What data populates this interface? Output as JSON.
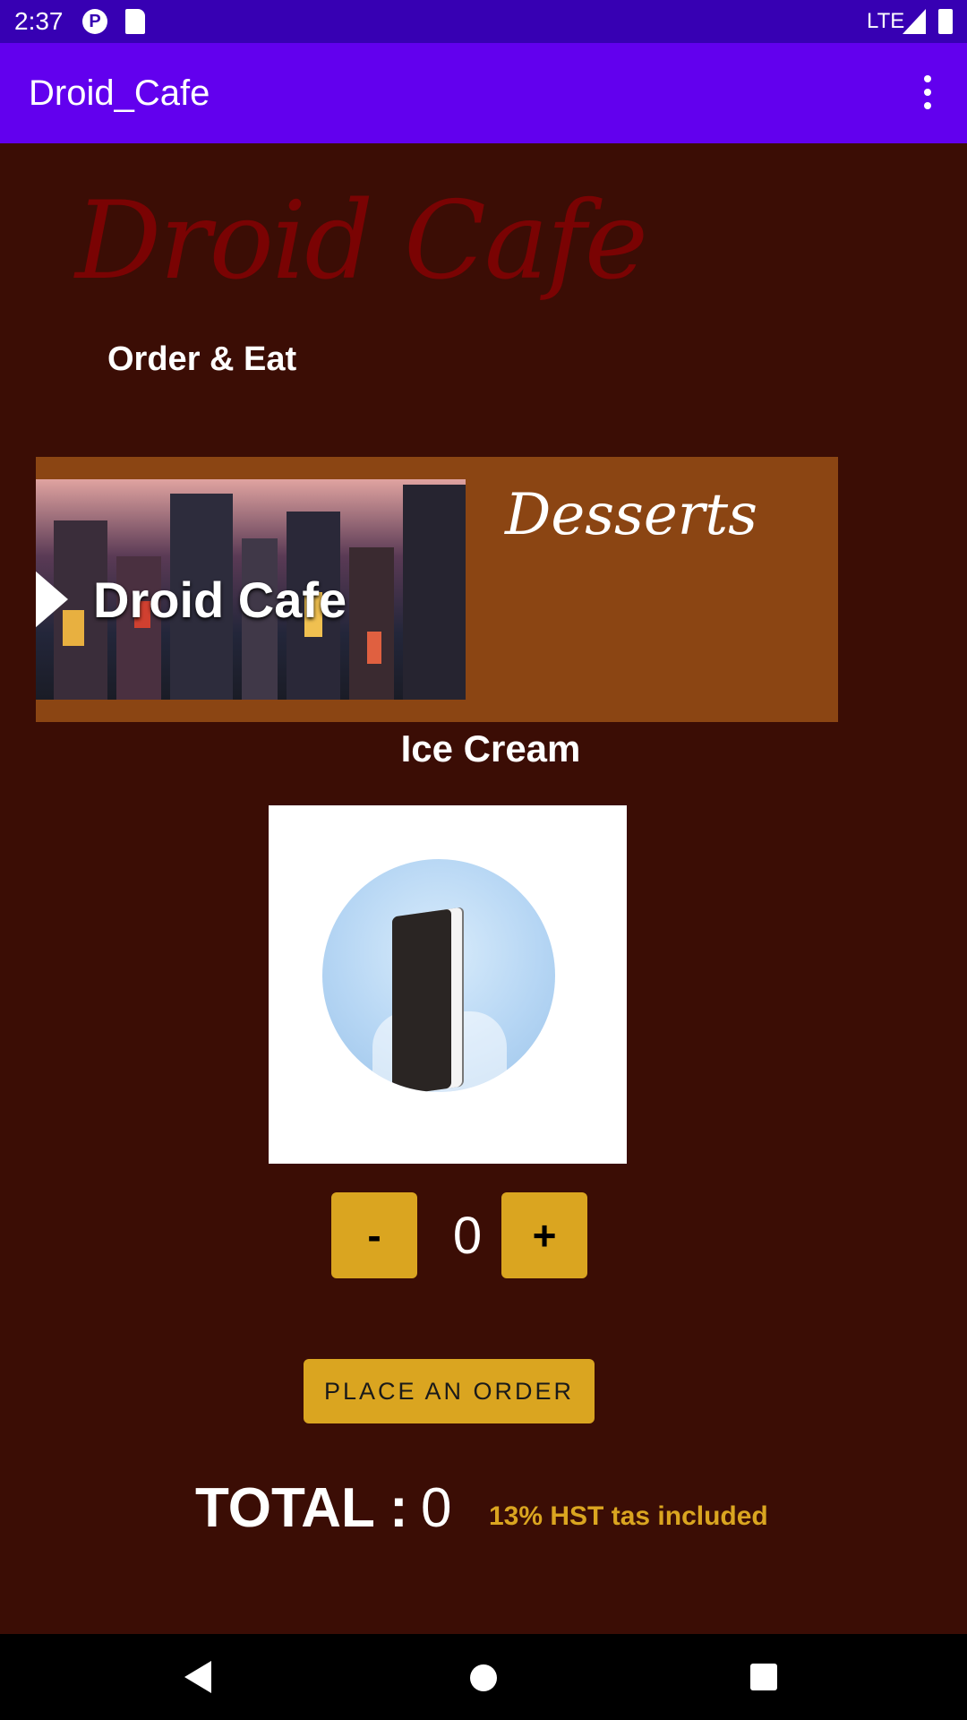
{
  "status_bar": {
    "time": "2:37",
    "network": "LTE"
  },
  "app_bar": {
    "title": "Droid_Cafe",
    "menu_icon": "more-vert-icon"
  },
  "header": {
    "logo_text": "Droid Cafe",
    "tagline": "Order & Eat"
  },
  "banner": {
    "image_text": "Droid Cafe",
    "heading": "Desserts"
  },
  "item": {
    "name": "Ice Cream"
  },
  "stepper": {
    "decrement_label": "-",
    "quantity": "0",
    "increment_label": "+"
  },
  "order": {
    "button_label": "PLACE AN ORDER"
  },
  "total": {
    "label": "TOTAL :",
    "value": "0",
    "tax_note": "13% HST tas included"
  },
  "colors": {
    "background": "#3b0d05",
    "app_bar": "#6200ee",
    "status_bar": "#3700b3",
    "accent": "#daa520",
    "banner": "#8b4513"
  }
}
